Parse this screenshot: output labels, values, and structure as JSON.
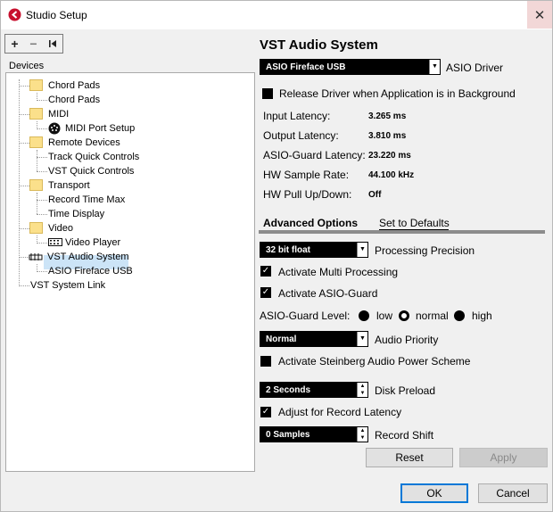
{
  "window": {
    "title": "Studio Setup"
  },
  "toolbar": {
    "add_label": "+",
    "remove_label": "−",
    "reset_label": "I◀"
  },
  "devices": {
    "label": "Devices",
    "items": {
      "chord_pads_folder": "Chord Pads",
      "chord_pads": "Chord Pads",
      "midi_folder": "MIDI",
      "midi_port_setup": "MIDI Port Setup",
      "remote_devices_folder": "Remote Devices",
      "track_quick_controls": "Track Quick Controls",
      "vst_quick_controls": "VST Quick Controls",
      "transport_folder": "Transport",
      "record_time_max": "Record Time Max",
      "time_display": "Time Display",
      "video_folder": "Video",
      "video_player": "Video Player",
      "vst_audio_system": "VST Audio System",
      "asio_fireface": "ASIO Fireface USB",
      "vst_system_link": "VST System Link"
    }
  },
  "panel": {
    "title": "VST Audio System",
    "asio_driver_value": "ASIO Fireface USB",
    "asio_driver_label": "ASIO Driver",
    "release_driver_label": "Release Driver when Application is in Background",
    "release_driver_checked": false,
    "latency": {
      "input_label": "Input Latency:",
      "input_value": "3.265 ms",
      "output_label": "Output Latency:",
      "output_value": "3.810 ms",
      "asio_guard_label": "ASIO-Guard Latency:",
      "asio_guard_value": "23.220 ms",
      "sample_rate_label": "HW Sample Rate:",
      "sample_rate_value": "44.100 kHz",
      "pull_label": "HW Pull Up/Down:",
      "pull_value": "Off"
    },
    "tabs": {
      "advanced": "Advanced Options",
      "defaults": "Set to Defaults"
    },
    "processing_precision_value": "32 bit float",
    "processing_precision_label": "Processing Precision",
    "multi_processing_label": "Activate Multi Processing",
    "multi_processing_checked": true,
    "asio_guard_label": "Activate ASIO-Guard",
    "asio_guard_checked": true,
    "asio_guard_level_label": "ASIO-Guard Level:",
    "levels": [
      "low",
      "normal",
      "high"
    ],
    "selected_level": "normal",
    "audio_priority_value": "Normal",
    "audio_priority_label": "Audio Priority",
    "power_scheme_label": "Activate Steinberg Audio Power Scheme",
    "power_scheme_checked": false,
    "disk_preload_value": "2 Seconds",
    "disk_preload_label": "Disk Preload",
    "adjust_latency_label": "Adjust for Record Latency",
    "adjust_latency_checked": true,
    "record_shift_value": "0 Samples",
    "record_shift_label": "Record Shift",
    "reset_label": "Reset",
    "apply_label": "Apply"
  },
  "footer": {
    "ok_label": "OK",
    "cancel_label": "Cancel"
  },
  "colors": {
    "selection": "#cce4f7",
    "folder": "#fbe08b",
    "accent": "#0078d7",
    "close_bg": "#f2d7d7"
  }
}
